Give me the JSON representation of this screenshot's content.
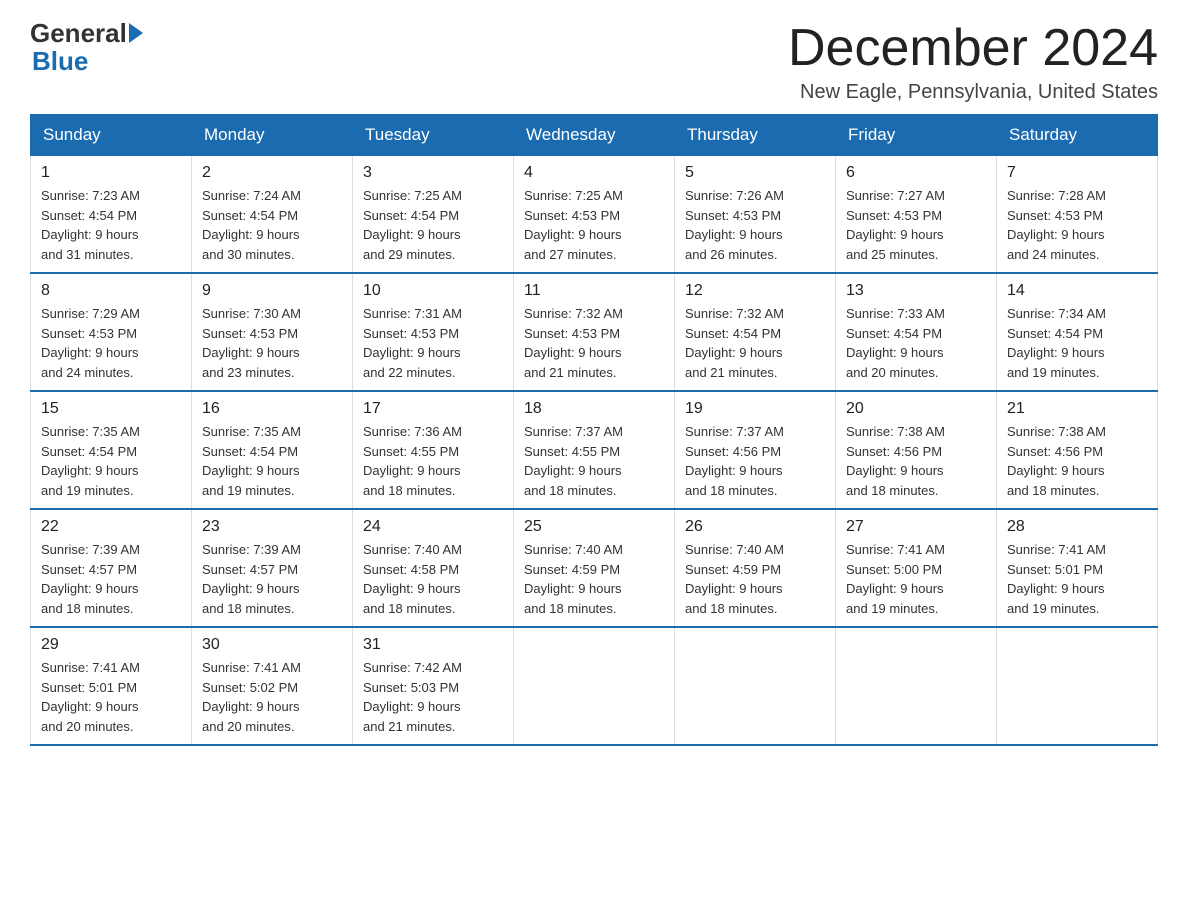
{
  "logo": {
    "general": "General",
    "blue": "Blue"
  },
  "title": "December 2024",
  "location": "New Eagle, Pennsylvania, United States",
  "weekdays": [
    "Sunday",
    "Monday",
    "Tuesday",
    "Wednesday",
    "Thursday",
    "Friday",
    "Saturday"
  ],
  "weeks": [
    [
      {
        "day": "1",
        "sunrise": "7:23 AM",
        "sunset": "4:54 PM",
        "daylight": "9 hours and 31 minutes."
      },
      {
        "day": "2",
        "sunrise": "7:24 AM",
        "sunset": "4:54 PM",
        "daylight": "9 hours and 30 minutes."
      },
      {
        "day": "3",
        "sunrise": "7:25 AM",
        "sunset": "4:54 PM",
        "daylight": "9 hours and 29 minutes."
      },
      {
        "day": "4",
        "sunrise": "7:25 AM",
        "sunset": "4:53 PM",
        "daylight": "9 hours and 27 minutes."
      },
      {
        "day": "5",
        "sunrise": "7:26 AM",
        "sunset": "4:53 PM",
        "daylight": "9 hours and 26 minutes."
      },
      {
        "day": "6",
        "sunrise": "7:27 AM",
        "sunset": "4:53 PM",
        "daylight": "9 hours and 25 minutes."
      },
      {
        "day": "7",
        "sunrise": "7:28 AM",
        "sunset": "4:53 PM",
        "daylight": "9 hours and 24 minutes."
      }
    ],
    [
      {
        "day": "8",
        "sunrise": "7:29 AM",
        "sunset": "4:53 PM",
        "daylight": "9 hours and 24 minutes."
      },
      {
        "day": "9",
        "sunrise": "7:30 AM",
        "sunset": "4:53 PM",
        "daylight": "9 hours and 23 minutes."
      },
      {
        "day": "10",
        "sunrise": "7:31 AM",
        "sunset": "4:53 PM",
        "daylight": "9 hours and 22 minutes."
      },
      {
        "day": "11",
        "sunrise": "7:32 AM",
        "sunset": "4:53 PM",
        "daylight": "9 hours and 21 minutes."
      },
      {
        "day": "12",
        "sunrise": "7:32 AM",
        "sunset": "4:54 PM",
        "daylight": "9 hours and 21 minutes."
      },
      {
        "day": "13",
        "sunrise": "7:33 AM",
        "sunset": "4:54 PM",
        "daylight": "9 hours and 20 minutes."
      },
      {
        "day": "14",
        "sunrise": "7:34 AM",
        "sunset": "4:54 PM",
        "daylight": "9 hours and 19 minutes."
      }
    ],
    [
      {
        "day": "15",
        "sunrise": "7:35 AM",
        "sunset": "4:54 PM",
        "daylight": "9 hours and 19 minutes."
      },
      {
        "day": "16",
        "sunrise": "7:35 AM",
        "sunset": "4:54 PM",
        "daylight": "9 hours and 19 minutes."
      },
      {
        "day": "17",
        "sunrise": "7:36 AM",
        "sunset": "4:55 PM",
        "daylight": "9 hours and 18 minutes."
      },
      {
        "day": "18",
        "sunrise": "7:37 AM",
        "sunset": "4:55 PM",
        "daylight": "9 hours and 18 minutes."
      },
      {
        "day": "19",
        "sunrise": "7:37 AM",
        "sunset": "4:56 PM",
        "daylight": "9 hours and 18 minutes."
      },
      {
        "day": "20",
        "sunrise": "7:38 AM",
        "sunset": "4:56 PM",
        "daylight": "9 hours and 18 minutes."
      },
      {
        "day": "21",
        "sunrise": "7:38 AM",
        "sunset": "4:56 PM",
        "daylight": "9 hours and 18 minutes."
      }
    ],
    [
      {
        "day": "22",
        "sunrise": "7:39 AM",
        "sunset": "4:57 PM",
        "daylight": "9 hours and 18 minutes."
      },
      {
        "day": "23",
        "sunrise": "7:39 AM",
        "sunset": "4:57 PM",
        "daylight": "9 hours and 18 minutes."
      },
      {
        "day": "24",
        "sunrise": "7:40 AM",
        "sunset": "4:58 PM",
        "daylight": "9 hours and 18 minutes."
      },
      {
        "day": "25",
        "sunrise": "7:40 AM",
        "sunset": "4:59 PM",
        "daylight": "9 hours and 18 minutes."
      },
      {
        "day": "26",
        "sunrise": "7:40 AM",
        "sunset": "4:59 PM",
        "daylight": "9 hours and 18 minutes."
      },
      {
        "day": "27",
        "sunrise": "7:41 AM",
        "sunset": "5:00 PM",
        "daylight": "9 hours and 19 minutes."
      },
      {
        "day": "28",
        "sunrise": "7:41 AM",
        "sunset": "5:01 PM",
        "daylight": "9 hours and 19 minutes."
      }
    ],
    [
      {
        "day": "29",
        "sunrise": "7:41 AM",
        "sunset": "5:01 PM",
        "daylight": "9 hours and 20 minutes."
      },
      {
        "day": "30",
        "sunrise": "7:41 AM",
        "sunset": "5:02 PM",
        "daylight": "9 hours and 20 minutes."
      },
      {
        "day": "31",
        "sunrise": "7:42 AM",
        "sunset": "5:03 PM",
        "daylight": "9 hours and 21 minutes."
      },
      null,
      null,
      null,
      null
    ]
  ],
  "labels": {
    "sunrise": "Sunrise:",
    "sunset": "Sunset:",
    "daylight": "Daylight:"
  }
}
